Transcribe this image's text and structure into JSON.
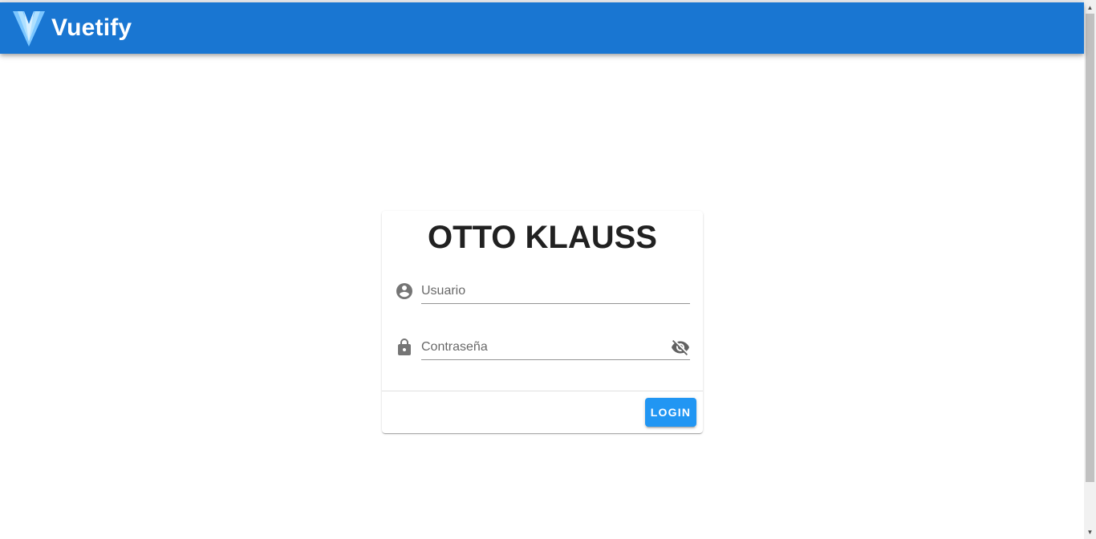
{
  "app_bar": {
    "brand": "Vuetify",
    "logo_icon": "vuetify-logo",
    "background_color": "#1976d2"
  },
  "login_card": {
    "title": "OTTO KLAUSS",
    "username": {
      "icon": "account-circle-icon",
      "placeholder": "Usuario",
      "value": ""
    },
    "password": {
      "icon": "lock-icon",
      "placeholder": "Contraseña",
      "value": "",
      "visibility_icon": "eye-off-icon"
    },
    "login_button": {
      "label": "LOGIN",
      "color": "#2196f3"
    }
  }
}
